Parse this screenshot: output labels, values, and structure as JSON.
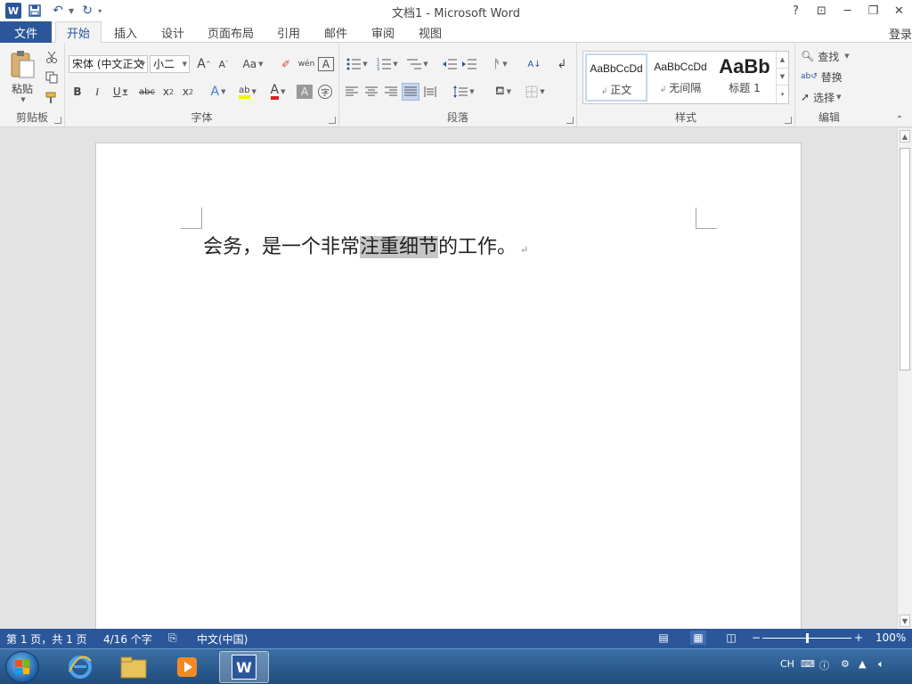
{
  "window": {
    "title": "文档1 - Microsoft Word",
    "help": "?",
    "ribbon_display": "⊡",
    "minimize": "─",
    "restore": "❐",
    "close": "✕"
  },
  "qat": {
    "app_logo": "W",
    "save_icon": "save-icon",
    "undo": "↶",
    "redo": "↻"
  },
  "tabs": {
    "file": "文件",
    "items": [
      "开始",
      "插入",
      "设计",
      "页面布局",
      "引用",
      "邮件",
      "审阅",
      "视图"
    ],
    "active": "开始",
    "login": "登录"
  },
  "ribbon": {
    "clipboard": {
      "label": "剪贴板",
      "paste": "粘贴"
    },
    "font": {
      "label": "字体",
      "font_name": "宋体 (中文正文",
      "font_size": "小二",
      "grow": "A",
      "shrink": "A",
      "change_case": "Aa",
      "phonetic": "wén",
      "char_border": "A",
      "bold": "B",
      "italic": "I",
      "underline": "U",
      "strike": "abc",
      "subscript": "x",
      "superscript": "x",
      "text_effects": "A",
      "highlight": "ab",
      "font_color": "A",
      "char_shading": "A",
      "enclose": "字"
    },
    "paragraph": {
      "label": "段落"
    },
    "styles": {
      "label": "样式",
      "items": [
        {
          "sample": "AaBbCcDd",
          "name": "正文"
        },
        {
          "sample": "AaBbCcDd",
          "name": "无间隔"
        },
        {
          "sample": "AaBb",
          "name": "标题 1"
        }
      ]
    },
    "editing": {
      "label": "编辑",
      "find": "查找",
      "replace": "替换",
      "select": "选择"
    }
  },
  "document": {
    "text_before": "会务，是一个非常",
    "text_selected": "注重细节",
    "text_after": "的工作。",
    "paragraph_mark": "↵"
  },
  "status": {
    "page": "第 1 页，共 1 页",
    "words": "4/16 个字",
    "language": "中文(中国)",
    "zoom": "100%",
    "zoom_minus": "−",
    "zoom_plus": "+",
    "zoom_level": 1.0
  },
  "taskbar": {
    "tray_lang": "CH"
  }
}
